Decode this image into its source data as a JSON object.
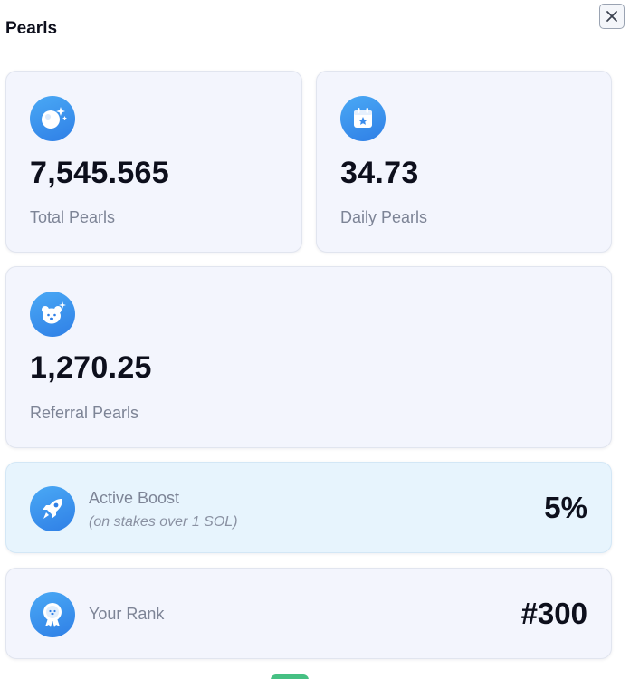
{
  "header": {
    "title": "Pearls"
  },
  "cards": {
    "total": {
      "value": "7,545.565",
      "label": "Total Pearls",
      "icon": "pearl-icon"
    },
    "daily": {
      "value": "34.73",
      "label": "Daily Pearls",
      "icon": "calendar-star-icon"
    },
    "referral": {
      "value": "1,270.25",
      "label": "Referral Pearls",
      "icon": "bear-face-icon"
    },
    "boost": {
      "label": "Active Boost",
      "note": "(on stakes over 1 SOL)",
      "value": "5%",
      "icon": "rocket-icon"
    },
    "rank": {
      "label": "Your Rank",
      "value": "#300",
      "icon": "medal-icon"
    }
  },
  "colors": {
    "icon_gradient_start": "#4aa9f5",
    "icon_gradient_end": "#2f7fe6",
    "card_bg": "#f3f5fd",
    "boost_bg": "#e7f4fd",
    "label_gray": "#7d8496"
  }
}
